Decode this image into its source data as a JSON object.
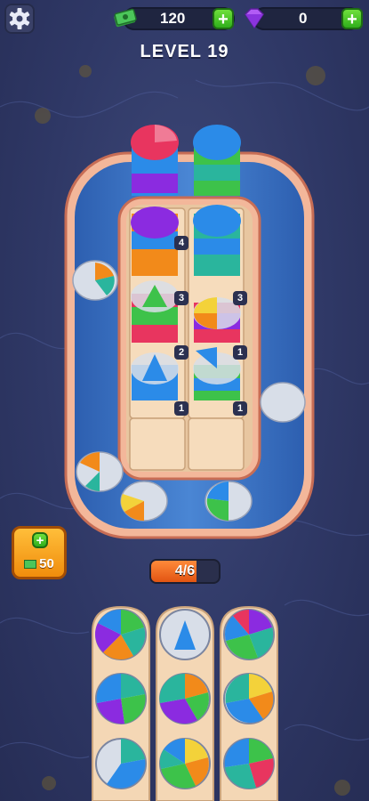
{
  "hud": {
    "cash_value": "120",
    "gems_value": "0",
    "level_label": "LEVEL 19",
    "cash_icon": "cash-stack-icon",
    "gem_icon": "gem-icon",
    "settings_icon": "gear-icon"
  },
  "booster": {
    "price": "50",
    "icon": "cash-icon"
  },
  "progress": {
    "text": "4/6",
    "fraction": 0.67
  },
  "stack_counts": [
    "4",
    "3",
    "3",
    "2",
    "1",
    "1",
    "1"
  ],
  "colors": {
    "pink": "#e8355f",
    "blue": "#2b8be8",
    "purple": "#8b2be0",
    "orange": "#f28a1a",
    "green": "#3dc24a",
    "teal": "#2ab59d",
    "yellow": "#f3d23a",
    "belt": "#3a6fc2",
    "rim": "#f0a586",
    "wood": "#f4d7b5"
  }
}
